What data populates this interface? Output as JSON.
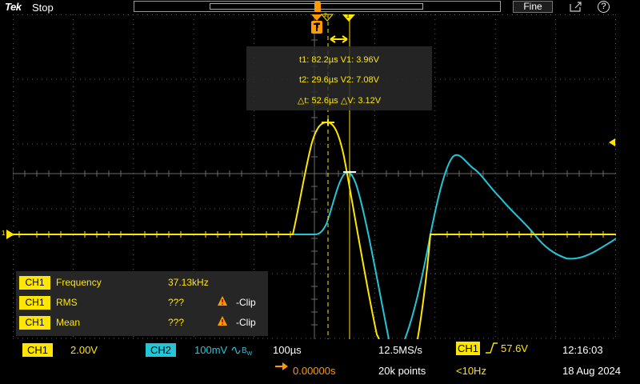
{
  "header": {
    "brand": "Tek",
    "run_state": "Stop",
    "fine_label": "Fine",
    "help_label": "?"
  },
  "trigger_marker_label": "T",
  "channel1_ground_label": "1",
  "cursor_labels": {
    "c1": "2",
    "c2": "1"
  },
  "cursor_readout": {
    "line1": "t1: 82.2µs  V1: 3.96V",
    "line2": "t2: 29.6µs  V2: 7.08V",
    "line3": "△t: 52.6µs  △V: 3.12V"
  },
  "measurements": [
    {
      "channel": "CH1",
      "name": "Frequency",
      "value": "37.13kHz",
      "status": ""
    },
    {
      "channel": "CH1",
      "name": "RMS",
      "value": "???",
      "status": "-Clip"
    },
    {
      "channel": "CH1",
      "name": "Mean",
      "value": "???",
      "status": "-Clip"
    }
  ],
  "bottom": {
    "ch1_label": "CH1",
    "ch1_scale": "2.00V",
    "ch2_label": "CH2",
    "ch2_scale": "100mV",
    "ch2_bw": "B",
    "ch2_bw_sub": "W",
    "timebase": "100µs",
    "delay": "0.00000s",
    "sample_rate": "12.5MS/s",
    "record_length": "20k points",
    "trig_source": "CH1",
    "trig_level": "57.6V",
    "trig_freq": "<10Hz",
    "time": "12:16:03",
    "date": "18 Aug 2024"
  },
  "colors": {
    "ch1": "#ffe600",
    "ch2": "#22c6d6",
    "trigger": "#ff9a00",
    "grid": "#5a5a5a"
  },
  "icons": [
    "save-icon",
    "help-icon",
    "warning-icon",
    "trigger-marker-icon",
    "delay-arrow-icon",
    "rising-edge-icon"
  ]
}
